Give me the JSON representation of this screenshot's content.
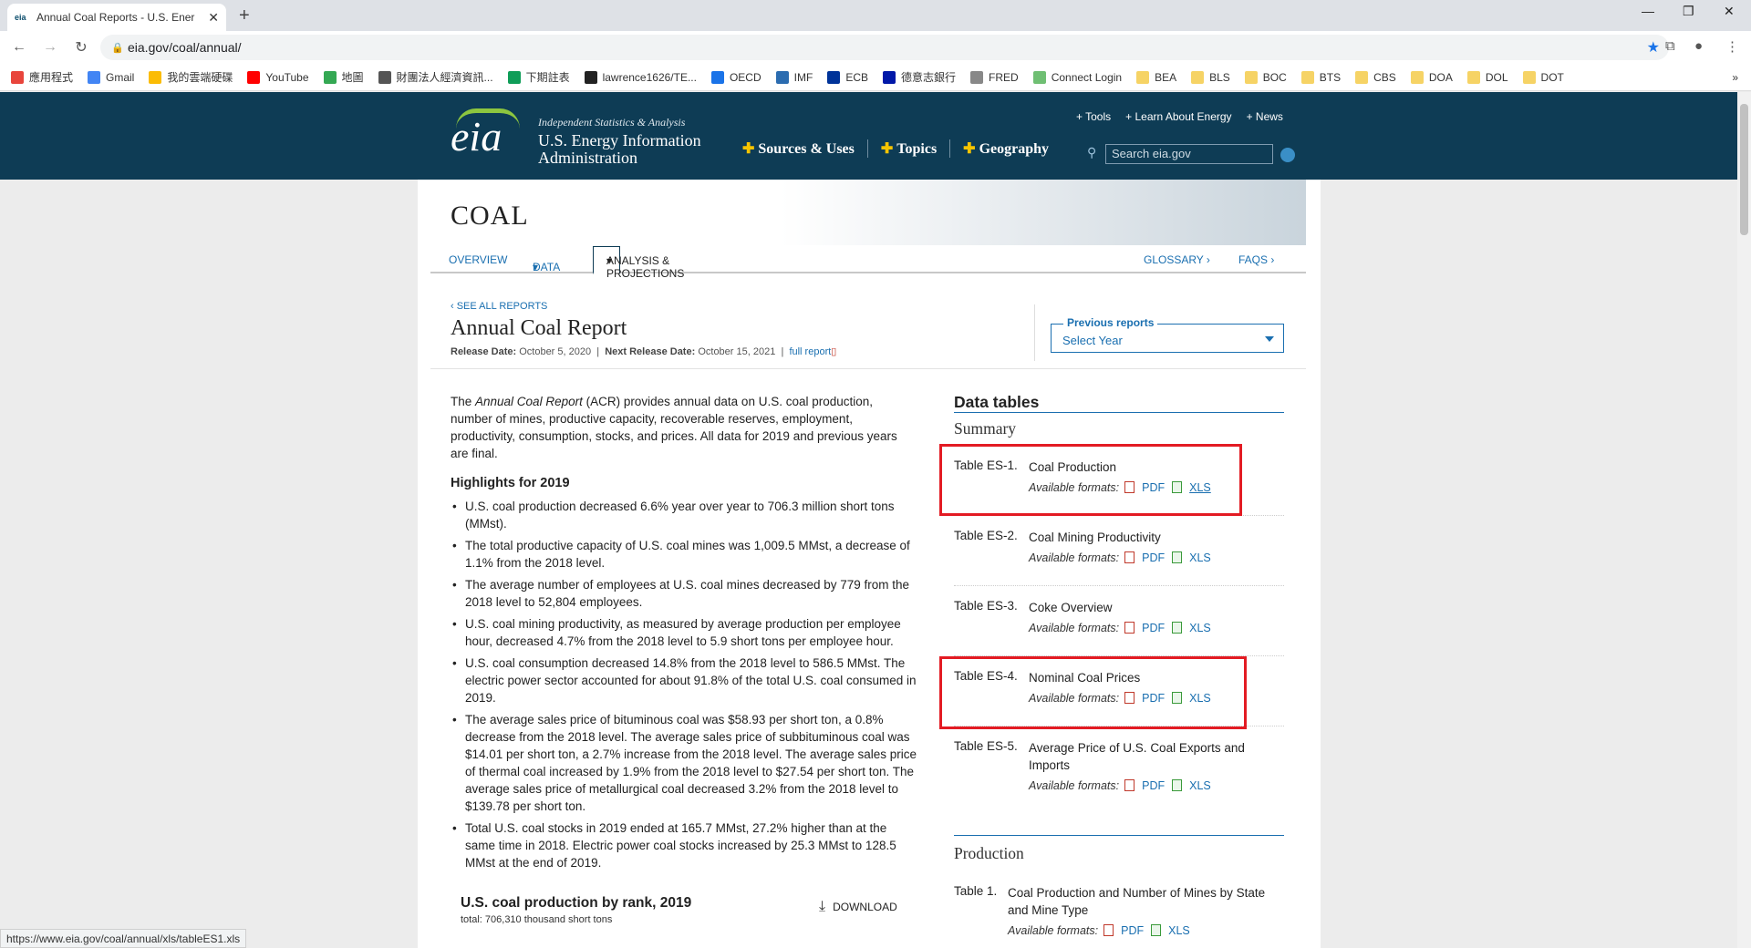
{
  "browser": {
    "tab_title": "Annual Coal Reports - U.S. Ener",
    "tab_favicon": "eia",
    "url": "eia.gov/coal/annual/",
    "status_url": "https://www.eia.gov/coal/annual/xls/tableES1.xls",
    "bookmarks": [
      "應用程式",
      "Gmail",
      "我的雲端硬碟",
      "YouTube",
      "地圖",
      "財團法人經濟資訊...",
      "下期註表",
      "lawrence1626/TE...",
      "OECD",
      "IMF",
      "ECB",
      "德意志銀行",
      "FRED",
      "Connect Login",
      "BEA",
      "BLS",
      "BOC",
      "BTS",
      "CBS",
      "DOA",
      "DOL",
      "DOT"
    ],
    "bookmarks_more": "»"
  },
  "header": {
    "logo": "eia",
    "tagline": "Independent Statistics & Analysis",
    "agency": "U.S. Energy Information Administration",
    "util_links": [
      "+ Tools",
      "+ Learn About Energy",
      "+ News"
    ],
    "nav": [
      "Sources & Uses",
      "Topics",
      "Geography"
    ],
    "search_placeholder": "Search eia.gov"
  },
  "section": {
    "title": "COAL",
    "tabs": [
      "OVERVIEW",
      "DATA",
      "ANALYSIS & PROJECTIONS"
    ],
    "right_links": [
      "GLOSSARY ›",
      "FAQS ›"
    ]
  },
  "report": {
    "breadcrumb": "‹ SEE ALL REPORTS",
    "title": "Annual Coal Report",
    "release_label": "Release Date:",
    "release_date": "October 5, 2020",
    "next_label": "Next Release Date:",
    "next_date": "October 15, 2021",
    "full_report": "full report",
    "previous_label": "Previous reports",
    "select_year": "Select Year"
  },
  "intro": {
    "pre": "The ",
    "italic": "Annual Coal Report",
    "post": " (ACR) provides annual data on U.S. coal production, number of mines, productive capacity, recoverable reserves, employment, productivity, consumption, stocks, and prices. All data for 2019 and previous years are final."
  },
  "highlights": {
    "title": "Highlights for 2019",
    "items": [
      "U.S. coal production decreased 6.6% year over year to 706.3 million short tons (MMst).",
      "The total productive capacity of U.S. coal mines was 1,009.5 MMst, a decrease of 1.1% from the 2018 level.",
      "The average number of employees at U.S. coal mines decreased by 779 from the 2018 level to 52,804 employees.",
      "U.S. coal mining productivity, as measured by average production per employee hour, decreased 4.7% from the 2018 level to 5.9 short tons per employee hour.",
      "U.S. coal consumption decreased 14.8% from the 2018 level to 586.5 MMst. The electric power sector accounted for about 91.8% of the total U.S. coal consumed in 2019.",
      "The average sales price of bituminous coal was $58.93 per short ton, a 0.8% decrease from the 2018 level. The average sales price of subbituminous coal was $14.01 per short ton, a 2.7% increase from the 2018 level. The average sales price of thermal coal increased by 1.9% from the 2018 level to $27.54 per short ton. The average sales price of metallurgical coal decreased 3.2% from the 2018 level to $139.78 per short ton.",
      "Total U.S. coal stocks in 2019 ended at 165.7 MMst, 27.2% higher than at the same time in 2018. Electric power coal stocks increased by 25.3 MMst to 128.5 MMst at the end of 2019."
    ]
  },
  "chart": {
    "title": "U.S. coal production by rank, 2019",
    "subtitle": "total: 706,310 thousand short tons",
    "download": "DOWNLOAD"
  },
  "data_tables": {
    "title": "Data tables",
    "summary_label": "Summary",
    "formats_label": "Available formats:",
    "pdf": "PDF",
    "xls": "XLS",
    "summary_tables": [
      {
        "num": "Table ES-1.",
        "name": "Coal Production"
      },
      {
        "num": "Table ES-2.",
        "name": "Coal Mining Productivity"
      },
      {
        "num": "Table ES-3.",
        "name": "Coke Overview"
      },
      {
        "num": "Table ES-4.",
        "name": "Nominal Coal Prices"
      },
      {
        "num": "Table ES-5.",
        "name": "Average Price of U.S. Coal Exports and Imports"
      }
    ],
    "production_label": "Production",
    "production_tables": [
      {
        "num": "Table 1.",
        "name": "Coal Production and Number of Mines by State and Mine Type"
      }
    ]
  },
  "colors": {
    "header_bg": "#0e3c55",
    "link": "#1a6fb0",
    "highlight_box": "#e31b23",
    "accent_plus": "#f5c400"
  }
}
